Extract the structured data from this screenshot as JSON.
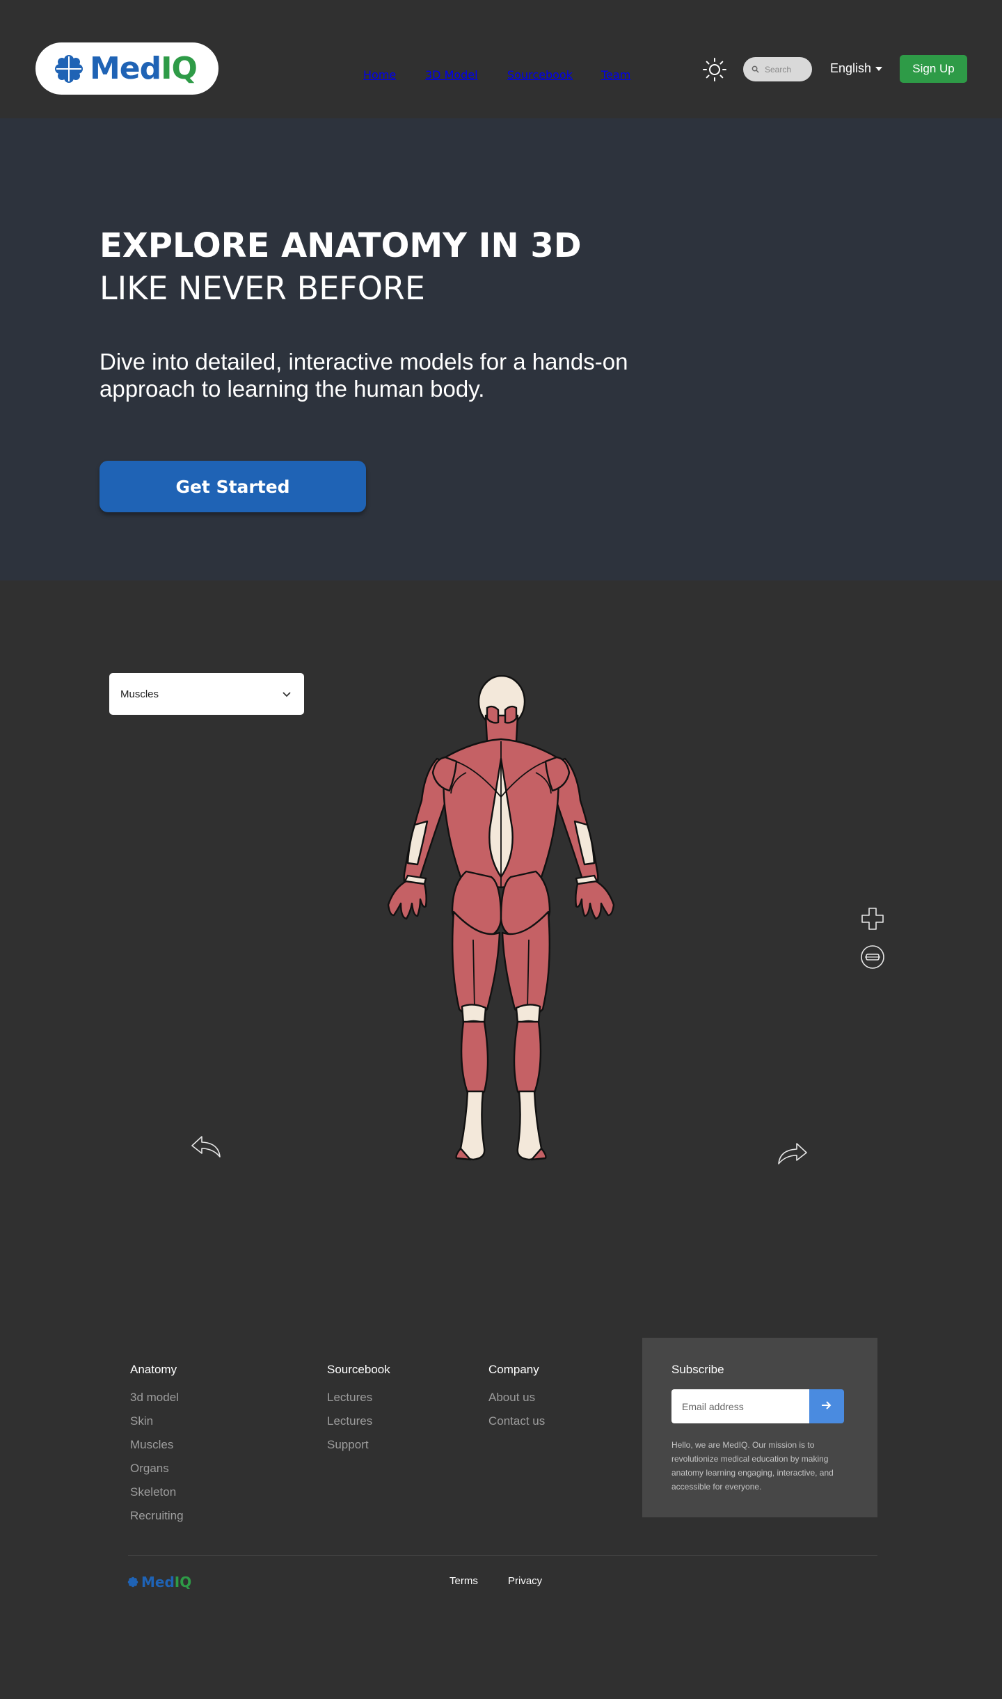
{
  "brand": {
    "name_part1": "Med",
    "name_part2": "IQ",
    "colors": {
      "blue": "#1f63b5",
      "green": "#2e9b47"
    }
  },
  "nav": {
    "links": [
      "Home",
      "3D Model",
      "Sourcebook",
      "Team"
    ],
    "search_placeholder": "Search",
    "language": "English",
    "signup_label": "Sign Up"
  },
  "hero": {
    "title_line1": "EXPLORE ANATOMY IN 3D",
    "title_line2": "LIKE NEVER BEFORE",
    "subtitle": "Dive into detailed, interactive models for a hands-on approach to learning the human body.",
    "cta_label": "Get Started"
  },
  "viewer": {
    "layer_select": "Muscles",
    "icons": [
      "zoom-in-plus-icon",
      "reset-view-icon",
      "rotate-left-icon",
      "rotate-right-icon"
    ]
  },
  "footer": {
    "columns": [
      {
        "title": "Anatomy",
        "links": [
          "3d model",
          "Skin",
          "Muscles",
          "Organs",
          "Skeleton",
          "Recruiting"
        ]
      },
      {
        "title": "Sourcebook",
        "links": [
          "Lectures",
          "Lectures",
          "Support"
        ]
      },
      {
        "title": "Company",
        "links": [
          "About us",
          "Contact us"
        ]
      }
    ],
    "subscribe": {
      "title": "Subscribe",
      "placeholder": "Email address",
      "text": "Hello, we are MedIQ. Our mission is to revolutionize medical education by making anatomy learning engaging, interactive, and accessible for everyone."
    },
    "bottom_links": [
      "Terms",
      "Privacy"
    ]
  }
}
